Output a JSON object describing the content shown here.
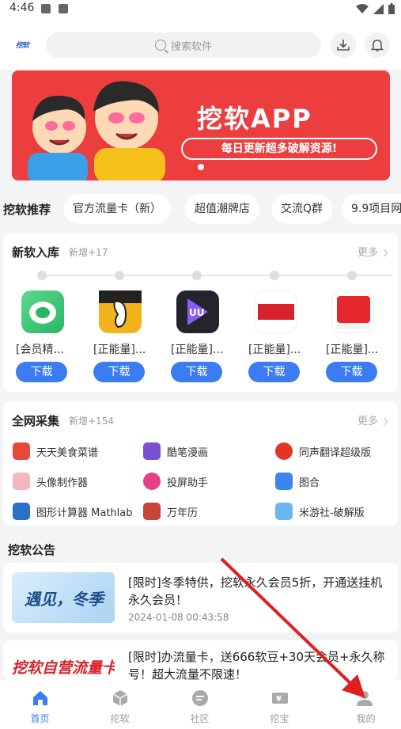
{
  "status_bar": {
    "time": "4:46"
  },
  "search": {
    "placeholder": "搜索软件"
  },
  "header": {
    "logo_text": "挖软"
  },
  "banner": {
    "title": "挖软APP",
    "subtitle": "每日更新超多破解资源!"
  },
  "recommend": {
    "label": "挖软推荐",
    "items": [
      "官方流量卡（新）",
      "超值潮牌店",
      "交流Q群",
      "9.9项目网"
    ]
  },
  "new_software": {
    "title": "新软入库",
    "count": "新增+17",
    "more": "更多",
    "apps": [
      {
        "name": "[会员精...",
        "button": "下载",
        "icon": "green-shield-icon"
      },
      {
        "name": "[正能量]...",
        "button": "下载",
        "icon": "banana-icon"
      },
      {
        "name": "[正能量]...",
        "button": "下载",
        "icon": "uu-video-icon"
      },
      {
        "name": "[正能量]...",
        "button": "下载",
        "icon": "tokyo-hot-icon"
      },
      {
        "name": "[正能量]...",
        "button": "下载",
        "icon": "91-icon"
      }
    ]
  },
  "collection": {
    "title": "全网采集",
    "count": "新增+154",
    "more": "更多",
    "items": [
      {
        "name": "天天美食菜谱",
        "color": "#e8483a"
      },
      {
        "name": "酷笔漫画",
        "color": "#7a4fd0"
      },
      {
        "name": "同声翻译超级版",
        "color": "#e6332a"
      },
      {
        "name": "头像制作器",
        "color": "#f4b6c2"
      },
      {
        "name": "投屏助手",
        "color": "#e6408a"
      },
      {
        "name": "图合",
        "color": "#3b86f0"
      },
      {
        "name": "图形计算器 Mathlab",
        "color": "#2a72c9"
      },
      {
        "name": "万年历",
        "color": "#c8453a"
      },
      {
        "name": "米游社-破解版",
        "color": "#69b6f2"
      }
    ]
  },
  "announcements": {
    "title": "挖软公告",
    "items": [
      {
        "text": "[限时]冬季特供，挖软永久会员5折，开通送挂机永久会员！",
        "time": "2024-01-08 00:43:58",
        "thumb_text": "遇见，冬季"
      },
      {
        "text": "[限时]办流量卡，送666软豆+30天会员+永久称号！超大流量不限速！",
        "time": "",
        "thumb_text": "挖软自营流量卡"
      }
    ]
  },
  "tabs": [
    {
      "label": "首页",
      "icon": "home-icon",
      "active": true
    },
    {
      "label": "挖软",
      "icon": "cube-icon",
      "active": false
    },
    {
      "label": "社区",
      "icon": "chat-icon",
      "active": false
    },
    {
      "label": "挖宝",
      "icon": "ticket-icon",
      "active": false
    },
    {
      "label": "我的",
      "icon": "user-icon",
      "active": false
    }
  ],
  "colors": {
    "accent": "#3b7cf3",
    "banner": "#ec3e3e",
    "arrow": "#e02020"
  }
}
